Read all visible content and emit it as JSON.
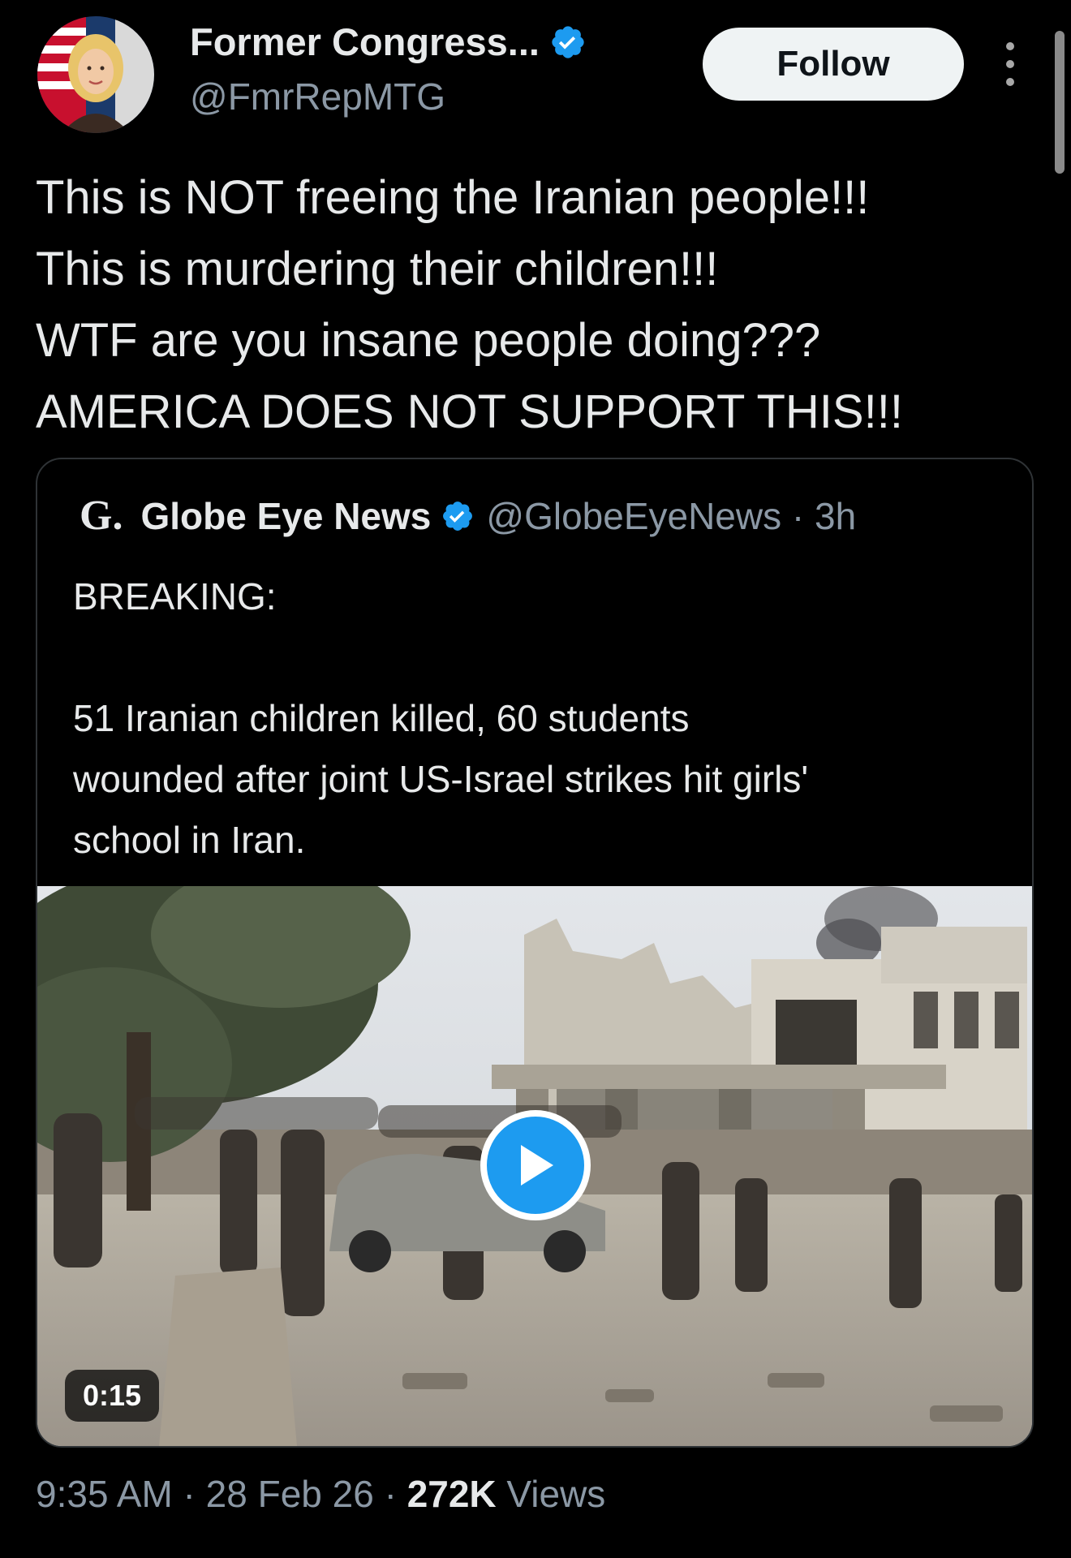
{
  "author": {
    "name": "Former Congress...",
    "handle": "@FmrRepMTG",
    "verified_icon": "verified-badge-icon",
    "follow_label": "Follow"
  },
  "tweet": {
    "lines": [
      "This is NOT freeing the Iranian people!!!",
      "This is murdering their children!!!",
      "WTF are you insane people doing???",
      "AMERICA DOES NOT SUPPORT THIS!!!"
    ]
  },
  "quote": {
    "logo": "G.",
    "name": "Globe Eye News",
    "handle": "@GlobeEyeNews · 3h",
    "lines": [
      "BREAKING:",
      "",
      "51 Iranian children killed, 60 students",
      "wounded after joint US-Israel strikes hit girls'",
      "school in Iran."
    ],
    "video_duration": "0:15"
  },
  "meta": {
    "time_date": "9:35 AM · 28 Feb 26 · ",
    "views_count": "272K",
    "views_label": " Views"
  },
  "colors": {
    "background": "#000000",
    "text": "#e7e9ea",
    "secondary": "#8b98a5",
    "accent": "#1d9bf0"
  }
}
